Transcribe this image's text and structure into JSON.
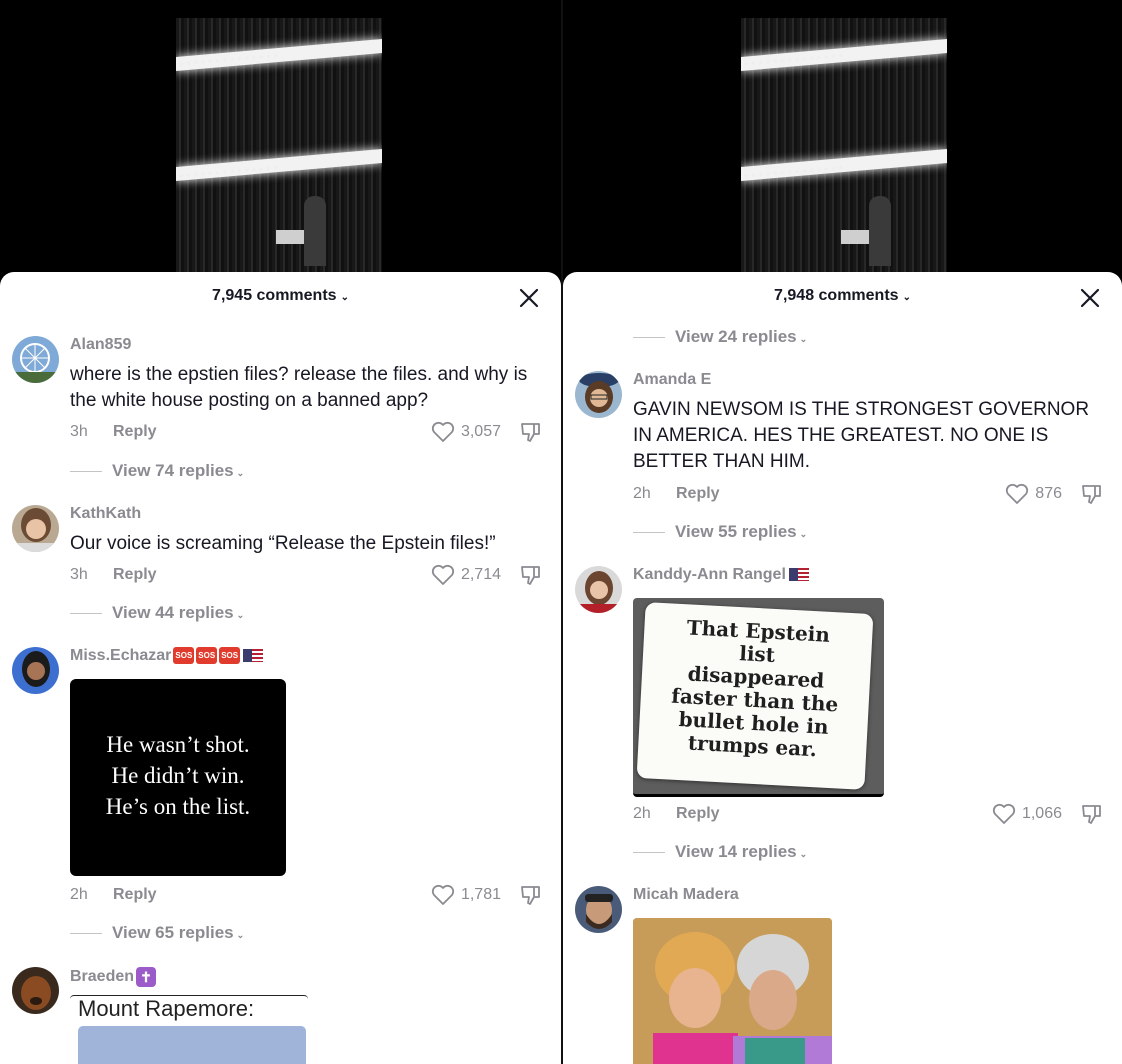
{
  "left": {
    "header": {
      "count_label": "7,945 comments"
    },
    "comments": [
      {
        "user": "Alan859",
        "text": "where is the epstien files? release the files. and why is the white house posting on a banned app?",
        "time": "3h",
        "reply": "Reply",
        "likes": "3,057",
        "view_replies": "View 74 replies"
      },
      {
        "user": "KathKath",
        "text": "Our voice is screaming “Release the Epstein files!”",
        "time": "3h",
        "reply": "Reply",
        "likes": "2,714",
        "view_replies": "View 44 replies"
      },
      {
        "user": "Miss.Echazar",
        "sos_badges": [
          "SOS",
          "SOS",
          "SOS"
        ],
        "image_lines": [
          "He wasn’t shot.",
          "He didn’t win.",
          "He’s on the list."
        ],
        "time": "2h",
        "reply": "Reply",
        "likes": "1,781",
        "view_replies": "View 65 replies"
      },
      {
        "user": "Braeden",
        "image_title": "Mount Rapemore:"
      }
    ]
  },
  "right": {
    "header": {
      "count_label": "7,948 comments"
    },
    "top_view_replies": "View 24 replies",
    "comments": [
      {
        "user": "Amanda E",
        "text": "GAVIN NEWSOM IS THE STRONGEST GOVERNOR IN AMERICA. HES THE GREATEST. NO ONE IS BETTER THAN HIM.",
        "time": "2h",
        "reply": "Reply",
        "likes": "876",
        "view_replies": "View 55 replies"
      },
      {
        "user": "Kanddy-Ann Rangel",
        "image_lines": [
          "That Epstein",
          "list",
          "disappeared",
          "faster than the",
          "bullet hole in",
          "trumps ear."
        ],
        "time": "2h",
        "reply": "Reply",
        "likes": "1,066",
        "view_replies": "View 14 replies"
      },
      {
        "user": "Micah Madera"
      }
    ]
  },
  "colors": {
    "muted": "#8a8b91",
    "text": "#161823",
    "sos": "#e03b2d"
  },
  "icons": [
    "close-icon",
    "heart-icon",
    "dislike-icon",
    "chevron-down-icon"
  ]
}
